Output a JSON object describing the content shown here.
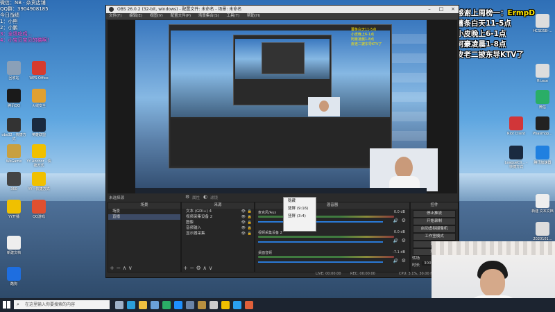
{
  "overlay_left": {
    "lines": [
      "微信：NB · 杂货店铺",
      "QQ群：3904908185",
      "今日战绩",
      "1：小熊",
      "2：小鹏",
      "3：全场吃鸡...",
      "4：小宝贝宝贝的猫啊！"
    ]
  },
  "overlay_right": {
    "line1_prefix": "感谢上周榜一：",
    "line1_name": "ErmpD",
    "line2": "薯条白天11-5点",
    "line3": "小皮晚上6-1点",
    "line4": "阿豪凌晨1-8点",
    "line5": "皮老二披东导KTV了"
  },
  "desktop_icons_left": [
    {
      "label": "回收站",
      "color": "#8aa0b8"
    },
    {
      "label": "WPS Office",
      "color": "#d63b2f"
    },
    {
      "label": "腾讯QQ",
      "color": "#1a1a1a"
    },
    {
      "label": "火绒安全",
      "color": "#e0a030"
    },
    {
      "label": "obs32 - 快捷方式",
      "color": "#333"
    },
    {
      "label": "英雄联盟",
      "color": "#1a2a40"
    },
    {
      "label": "WeGame",
      "color": "#c8a040"
    },
    {
      "label": "YY Anchor - 快捷方式",
      "color": "#f0c000"
    },
    {
      "label": "360",
      "color": "#444"
    },
    {
      "label": "YY - 快捷方式",
      "color": "#f0c000"
    },
    {
      "label": "YY开播",
      "color": "#f0c000"
    },
    {
      "label": "QQ游戏",
      "color": "#e05030"
    },
    {
      "label": "新建文档",
      "color": "#eee"
    },
    {
      "label": "酷狗",
      "color": "#1e6ee0"
    }
  ],
  "desktop_icons_right": [
    {
      "label": "HCSDSB-...",
      "color": "#ddd"
    },
    {
      "label": "Rt.exe",
      "color": "#ddd"
    },
    {
      "label": "微信",
      "color": "#2aae67"
    },
    {
      "label": "Riot Client",
      "color": "#d13639"
    },
    {
      "label": "Phasmop...",
      "color": "#222"
    },
    {
      "label": "LeagueCli... - 快捷方式",
      "color": "#1a2a40"
    },
    {
      "label": "腾讯加速器",
      "color": "#2080e0"
    },
    {
      "label": "新建 文本文档",
      "color": "#eee"
    },
    {
      "label": "2020101...",
      "color": "#ddd"
    }
  ],
  "obs": {
    "title": "OBS 26.0.2 (32-bit, windows) - 配置文件: 未命名 - 场景: 未命名",
    "menu": [
      "文件(F)",
      "编辑(E)",
      "视图(V)",
      "配置文件(P)",
      "场景集合(S)",
      "工具(T)",
      "帮助(H)"
    ],
    "source_bar": {
      "label": "未选择源",
      "props": "属性",
      "filters": "滤镜"
    },
    "scenes_header": "场景",
    "scenes": [
      "场景",
      "直播"
    ],
    "sources_header": "来源",
    "sources": [
      "文本 (GDI+) 4",
      "视频采集设备 2",
      "图像",
      "音频输入",
      "显示器采集"
    ],
    "mixer_header": "混音器",
    "mixer": [
      {
        "name": "麦克风/Aux",
        "db": "0.0 dB"
      },
      {
        "name": "视频采集设备 2",
        "db": "0.0 dB"
      },
      {
        "name": "桌面音频",
        "db": "-7.1 dB"
      }
    ],
    "context_menu": [
      "隐藏",
      "竖屏 (9:16)",
      "竖屏 (3:4)"
    ],
    "transition_header": "转场",
    "duration_label": "时长",
    "duration_value": "300 ms",
    "controls_header": "控件",
    "controls": [
      "停止推流",
      "开始录制",
      "启动虚拟摄像机",
      "工作室模式",
      "设置",
      "退出"
    ],
    "status": {
      "live": "LIVE: 00:00:00",
      "rec": "REC: 00:00:00",
      "cpu": "CPU: 3.1%, 30.00 fps"
    }
  },
  "taskbar": {
    "search_placeholder": "在这里输入你要搜索的内容",
    "apps": [
      {
        "name": "task-view",
        "color": "#9fb2c8"
      },
      {
        "name": "edge",
        "color": "#2b9fd9"
      },
      {
        "name": "file-explorer",
        "color": "#f0c040"
      },
      {
        "name": "store",
        "color": "#6aa0d8"
      },
      {
        "name": "wechat",
        "color": "#2aae67"
      },
      {
        "name": "qq",
        "color": "#1e90ff"
      },
      {
        "name": "steam",
        "color": "#6a84a8"
      },
      {
        "name": "league",
        "color": "#b89040"
      },
      {
        "name": "obs",
        "color": "#ccc"
      },
      {
        "name": "yy",
        "color": "#f0c000"
      },
      {
        "name": "browser",
        "color": "#2aa0f0"
      },
      {
        "name": "app",
        "color": "#e0603a"
      }
    ]
  }
}
